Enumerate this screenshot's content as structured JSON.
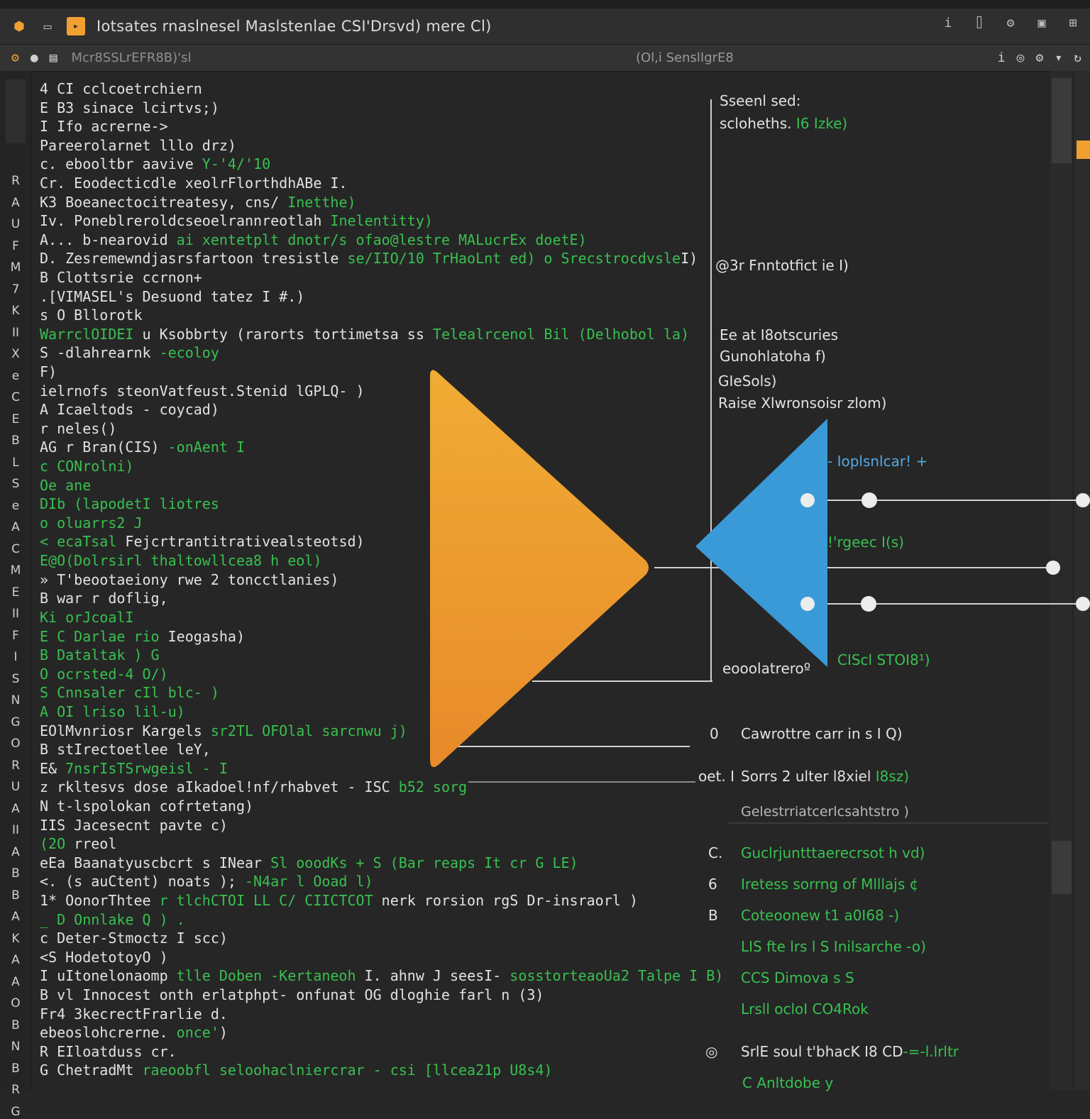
{
  "titlebar": {
    "title": "Iotsates rnaslnesel Maslstenlae CSI'Drsvd) mere Cl)",
    "icons": [
      "app-logo-icon",
      "folder-icon",
      "file-badge-icon",
      "info-icon",
      "bookmark-icon",
      "settings-icon",
      "layout-icon",
      "grid-icon"
    ]
  },
  "toolbar": {
    "label": "Mcr8SSLrEFR8B)'sl",
    "center": "(Ol,i  SenslIgrE8",
    "icons": [
      "build-icon",
      "chat-icon",
      "terminal-icon",
      "info-icon",
      "target-icon",
      "gear-icon",
      "arrow-down-icon",
      "share-icon"
    ]
  },
  "gutter_letters": [
    "R",
    "A",
    "U",
    "F",
    "M",
    "7",
    "K",
    "II",
    "X",
    "e",
    "C",
    "E",
    "B",
    "L",
    "S",
    "e",
    "A",
    "C",
    "M",
    "E",
    "II",
    "F",
    "I",
    "S",
    "N",
    "G",
    "O",
    "R",
    "U",
    "A",
    "II",
    "A",
    "B",
    "B",
    "A",
    "K",
    "A",
    "A",
    "O",
    "B",
    "N",
    "B",
    "R",
    "G"
  ],
  "code_lines": [
    [
      {
        "t": "4 CI cclcoetrchiern",
        "c": "w"
      }
    ],
    [
      {
        "t": "E  B3 sinace lcirtvs;)",
        "c": "w"
      }
    ],
    [
      {
        "t": "I  Ifo acrerne->",
        "c": "w"
      }
    ],
    [
      {
        "t": "   Pareerolarnet lllo drz)",
        "c": "w"
      }
    ],
    [
      {
        "t": "   c. ebooltbr aavive ",
        "c": "w"
      },
      {
        "t": "Y-'4/'10",
        "c": "g"
      }
    ],
    [
      {
        "t": "   Cr. Eoodecticdle xeolrFlorthdhABe I.",
        "c": "w"
      }
    ],
    [
      {
        "t": "   K3  Boeanectocitreatesy, cns/ ",
        "c": "w"
      },
      {
        "t": "Inetthe)",
        "c": "g"
      }
    ],
    [
      {
        "t": "   Iv. Poneblreroldcseoelrannreotlah ",
        "c": "w"
      },
      {
        "t": "Inelentitty)",
        "c": "g"
      }
    ],
    [
      {
        "t": "   A... b-nearovid ",
        "c": "w"
      },
      {
        "t": "ai xentetplt dnotr/s ofao@lestre MALucrEx doetE)",
        "c": "g"
      }
    ],
    [
      {
        "t": "   D.  Zesremewndjasrsfartoon  tresistle  ",
        "c": "w"
      },
      {
        "t": "se/IIO/10 TrHaoLnt ed) o Srecstrocdvsle",
        "c": "g"
      },
      {
        "t": "I)",
        "c": "w"
      }
    ],
    [
      {
        "t": "    B  Clottsrie ccrnon+",
        "c": "w"
      }
    ],
    [
      {
        "t": " .[VIMASEL's Desuond tatez I #.)",
        "c": "w"
      }
    ],
    [
      {
        "t": "   s  O Bllorotk",
        "c": "w"
      }
    ],
    [
      {
        "t": "    WarrclOIDEI ",
        "c": "g"
      },
      {
        "t": "u Ksobbrty (rarorts tortimetsa ss ",
        "c": "w"
      },
      {
        "t": "Telealrcenol Bil (Delhobol la)",
        "c": "g"
      }
    ],
    [
      {
        "t": "   S  -dlahrearnk ",
        "c": "w"
      },
      {
        "t": "-ecoloy",
        "c": "g"
      }
    ],
    [
      {
        "t": "   F)",
        "c": "w"
      }
    ],
    [
      {
        "t": "     ielrnofs steonVatfeust.Stenid lGPLQ- )",
        "c": "w"
      }
    ],
    [
      {
        "t": "   A  Icaeltods - coycad)",
        "c": "w"
      }
    ],
    [
      {
        "t": "   r neles()",
        "c": "w"
      }
    ],
    [
      {
        "t": " AG r Bran(CIS) ",
        "c": "w"
      },
      {
        "t": "-onAent I",
        "c": "g"
      }
    ],
    [
      {
        "t": "    c  CONrolni)",
        "c": "g"
      }
    ],
    [
      {
        "t": "       Oe ane",
        "c": "g"
      }
    ],
    [
      {
        "t": " DIb (lapodetI liotres",
        "c": "g"
      }
    ],
    [
      {
        "t": "   o   oluarrs2 J",
        "c": "g"
      }
    ],
    [
      {
        "t": "   <  ecaTsal ",
        "c": "g"
      },
      {
        "t": "Fejcrtrantitrativealsteotsd)",
        "c": "w"
      }
    ],
    [
      {
        "t": " E@O(Dolrsirl thaltowllcea8 h eol)",
        "c": "g"
      }
    ],
    [
      {
        "t": "   »  T'beootaeiony rwe 2 toncctlanies)",
        "c": "w"
      }
    ],
    [
      {
        "t": "   B  war r doflig,",
        "c": "w"
      }
    ],
    [
      {
        "t": "    Ki orJcoalI",
        "c": "g"
      }
    ],
    [
      {
        "t": " E C  ",
        "c": "g"
      },
      {
        "t": "Darlae rio ",
        "c": "g"
      },
      {
        "t": "Ieogasha)",
        "c": "w"
      }
    ],
    [
      {
        "t": "    B Dataltak ) G",
        "c": "g"
      }
    ],
    [
      {
        "t": "   O  ocrsted-4 O/)",
        "c": "g"
      }
    ],
    [
      {
        "t": "   S  Cnnsaler cIl blc- )",
        "c": "g"
      }
    ],
    [
      {
        "t": "   A  OI lriso lil-u)",
        "c": "g"
      }
    ],
    [
      {
        "t": " EOlMvnriosr Kargels  ",
        "c": "w"
      },
      {
        "t": "sr2TL OFOlal sarcnwu j)",
        "c": "g"
      }
    ],
    [
      {
        "t": "   B  stIrectoetlee leY,",
        "c": "w"
      }
    ],
    [
      {
        "t": "  E& ",
        "c": "w"
      },
      {
        "t": "7nsrIsTSrwgeisl - I",
        "c": "g"
      }
    ],
    [
      {
        "t": "   z  rkltesvs dose aIkadoel!nf/rhabvet - ISC ",
        "c": "w"
      },
      {
        "t": "b52 sorg",
        "c": "g"
      }
    ],
    [
      {
        "t": "  N t-lspolokan cofrtetang)",
        "c": "w"
      }
    ],
    [
      {
        "t": "  IIS Jacesecnt  pavte c)",
        "c": "w"
      }
    ],
    [
      {
        "t": " (2O ",
        "c": "g"
      },
      {
        "t": "rreol",
        "c": "w"
      }
    ],
    [
      {
        "t": "  eEa Baanatyuscbcrt  s INear ",
        "c": "w"
      },
      {
        "t": "Sl ooodKs + S (Bar reaps It cr G LE)",
        "c": "g"
      }
    ],
    [
      {
        "t": "   <. (s auCtent) noats  ); ",
        "c": "w"
      },
      {
        "t": "-N4ar l Ooad l)",
        "c": "g"
      }
    ],
    [
      {
        "t": "   1* OonorThtee ",
        "c": "w"
      },
      {
        "t": "r tlchCTOI LL C/ CIICTCOT",
        "c": "g"
      },
      {
        "t": " nerk rorsion rgS Dr-insraorl )",
        "c": "w"
      }
    ],
    [
      {
        "t": "   _ D Onnlake Q ) .",
        "c": "g"
      }
    ],
    [
      {
        "t": "   c   Deter-Stmoctz I scc)",
        "c": "w"
      }
    ],
    [
      {
        "t": "  <S HodetotoyO )",
        "c": "w"
      }
    ],
    [
      {
        "t": "     I  uItonelonaomp ",
        "c": "w"
      },
      {
        "t": "tlle Doben -Kertaneoh",
        "c": "g"
      },
      {
        "t": " I. ahnw J seesI- ",
        "c": "w"
      },
      {
        "t": "sosstorteaoUa2 Talpe I B)",
        "c": "g"
      }
    ],
    [
      {
        "t": "    B  vl Innocest onth erlatphpt- onfunat OG dloghie farl n (3)",
        "c": "w"
      }
    ],
    [
      {
        "t": " Fr4 3kecrectFrarlie d.",
        "c": "w"
      }
    ],
    [
      {
        "t": "   ebeoslohcrerne. ",
        "c": "w"
      },
      {
        "t": "once'",
        "c": "g"
      },
      {
        "t": ")",
        "c": "w"
      }
    ],
    [
      {
        "t": "   R  EIloatduss  cr.",
        "c": "w"
      }
    ],
    [
      {
        "t": "   G  ChetradMt ",
        "c": "w"
      },
      {
        "t": "raeoobfl seloohaclniercrar - csi [llcea21p U8s4)",
        "c": "g"
      }
    ]
  ],
  "right_panel": {
    "header_1": "Sseenl sed:",
    "header_2": "scloheths. ",
    "header_2_green": "I6 Izke)",
    "entry_1": "@3r Fnntotfict ie I)",
    "block_1": "Ee at I8otscuries",
    "block_2": "Gunohlatoha f)",
    "block_3": "GIeSols)",
    "block_4": "Raise  Xlwronsoisr zlom)",
    "blue_label": "- Ioplsnlcar! +",
    "mid_label": "!'rgeec I(s)",
    "node_label_white": "eooolatreroº",
    "node_label_green": "CIScl STOI8¹)",
    "section_mark_1": "0",
    "section_text_1": "Cawrottre carr in s I Q)",
    "section_mark_2": "oet. I",
    "section_text_2": "Sorrs 2 ulter l8xiel ",
    "section_text_2_green": "I8sz)",
    "section_text_3": "Gelestrriatcerlcsahtstro )",
    "list": [
      {
        "mark": "C.",
        "text": "Guclrjuntttaerecrsot h vd)",
        "color": "g"
      },
      {
        "mark": "6",
        "text": "Iretess sorrng of Mlllajs ¢",
        "color": "g"
      },
      {
        "mark": "B",
        "text": "Coteoonew t1 a0I68 -)",
        "color": "g"
      },
      {
        "mark": "",
        "text": "LIS fte lrs l S Inilsarche -o)",
        "color": "g"
      },
      {
        "mark": "",
        "text": "CCS Dimova s  S",
        "color": "g"
      },
      {
        "mark": "",
        "text": "Lrsll ocloI CO4Rok",
        "color": "g"
      }
    ],
    "footer_text": "SrlE soul t'bhacK I8  CD",
    "footer_text_green": "-=-l.lrltr",
    "footer_text_2": "C Anltdobe  y"
  },
  "colors": {
    "orange_top": "#f0ac34",
    "orange_bottom": "#e88a2a",
    "blue": "#3a9ad8",
    "background": "#262626",
    "green_text": "#38c050"
  }
}
